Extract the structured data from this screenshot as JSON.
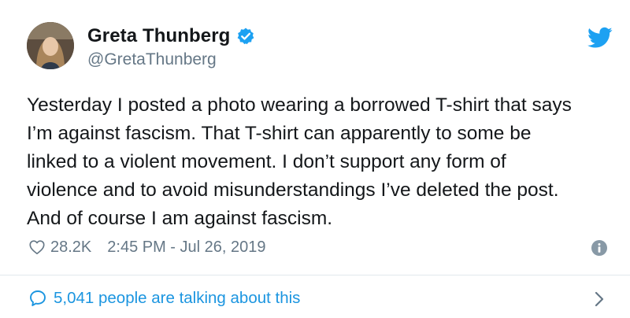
{
  "user": {
    "display_name": "Greta Thunberg",
    "handle": "@GretaThunberg",
    "verified": true
  },
  "tweet": {
    "text": "Yesterday I posted a photo wearing a borrowed T-shirt that says\nI’m against fascism. That T-shirt can apparently to some be\nlinked to a violent movement. I don’t support any form of\nviolence and to avoid misunderstandings I’ve deleted the post.\nAnd of course I am against fascism.",
    "likes": "28.2K",
    "timestamp": "2:45 PM - Jul 26, 2019"
  },
  "footer": {
    "talking_label": "5,041 people are talking about this"
  },
  "colors": {
    "brand_blue": "#1da1f2",
    "link_blue": "#1b95e0",
    "secondary_text": "#657786",
    "primary_text": "#14171a",
    "divider": "#e1e8ed"
  },
  "icons": {
    "verified": "verified-badge-icon",
    "brand": "twitter-bird-icon",
    "like": "heart-icon",
    "info": "info-icon",
    "reply": "speech-bubble-icon",
    "more": "chevron-right-icon"
  }
}
